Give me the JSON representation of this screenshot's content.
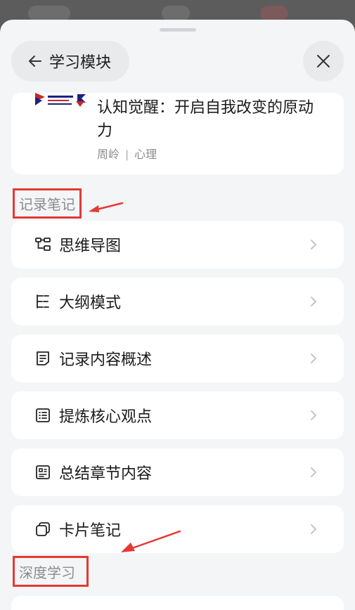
{
  "header": {
    "back_label": "学习模块"
  },
  "book": {
    "title": "认知觉醒：开启自我改变的原动力",
    "author": "周岭",
    "separator": "|",
    "category": "心理"
  },
  "sections": {
    "notes": "记录笔记",
    "deep_learning": "深度学习"
  },
  "menu_items": [
    {
      "label": "思维导图",
      "icon": "mindmap-icon"
    },
    {
      "label": "大纲模式",
      "icon": "outline-icon"
    },
    {
      "label": "记录内容概述",
      "icon": "document-icon"
    },
    {
      "label": "提炼核心观点",
      "icon": "list-icon"
    },
    {
      "label": "总结章节内容",
      "icon": "summary-icon"
    },
    {
      "label": "卡片笔记",
      "icon": "cards-icon"
    }
  ],
  "colors": {
    "highlight": "#e53935",
    "muted_text": "#8a8b8f",
    "sheet_bg": "#f4f5f7"
  }
}
